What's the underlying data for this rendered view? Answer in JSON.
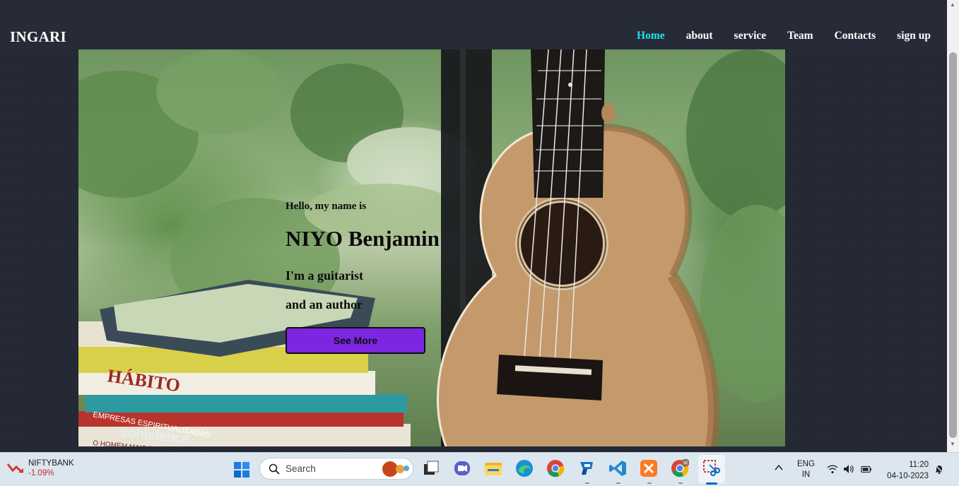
{
  "site": {
    "logo": "INGARI",
    "nav": [
      {
        "label": "Home",
        "active": true
      },
      {
        "label": "about",
        "active": false
      },
      {
        "label": "service",
        "active": false
      },
      {
        "label": "Team",
        "active": false
      },
      {
        "label": "Contacts",
        "active": false
      },
      {
        "label": "sign up",
        "active": false
      }
    ],
    "accent_color": "#1ee3e8"
  },
  "hero": {
    "greeting": "Hello, my name is",
    "name": "NIYO Benjamin",
    "role_line1": "I'm a guitarist",
    "role_line2": "and an author",
    "button_label": "See More",
    "button_color": "#7c26e0",
    "photo_book_text": [
      "HÁBITO",
      "EMPRESAS ESPIRITUALIZADAS",
      "confidence",
      "O HOMEM MAIS RICO DA"
    ]
  },
  "taskbar": {
    "stock_name": "NIFTYBANK",
    "stock_change": "-1.09%",
    "search_placeholder": "Search",
    "apps": [
      "start-icon",
      "task-view-icon",
      "teams-meet-icon",
      "file-explorer-icon",
      "edge-icon",
      "chrome-icon",
      "remote-desktop-icon",
      "vscode-icon",
      "xampp-icon",
      "chrome-profile-icon",
      "snipping-tool-icon"
    ],
    "chrome_profile_badge": "M",
    "language": "ENG",
    "region": "IN",
    "time": "11:20",
    "date": "04-10-2023"
  }
}
